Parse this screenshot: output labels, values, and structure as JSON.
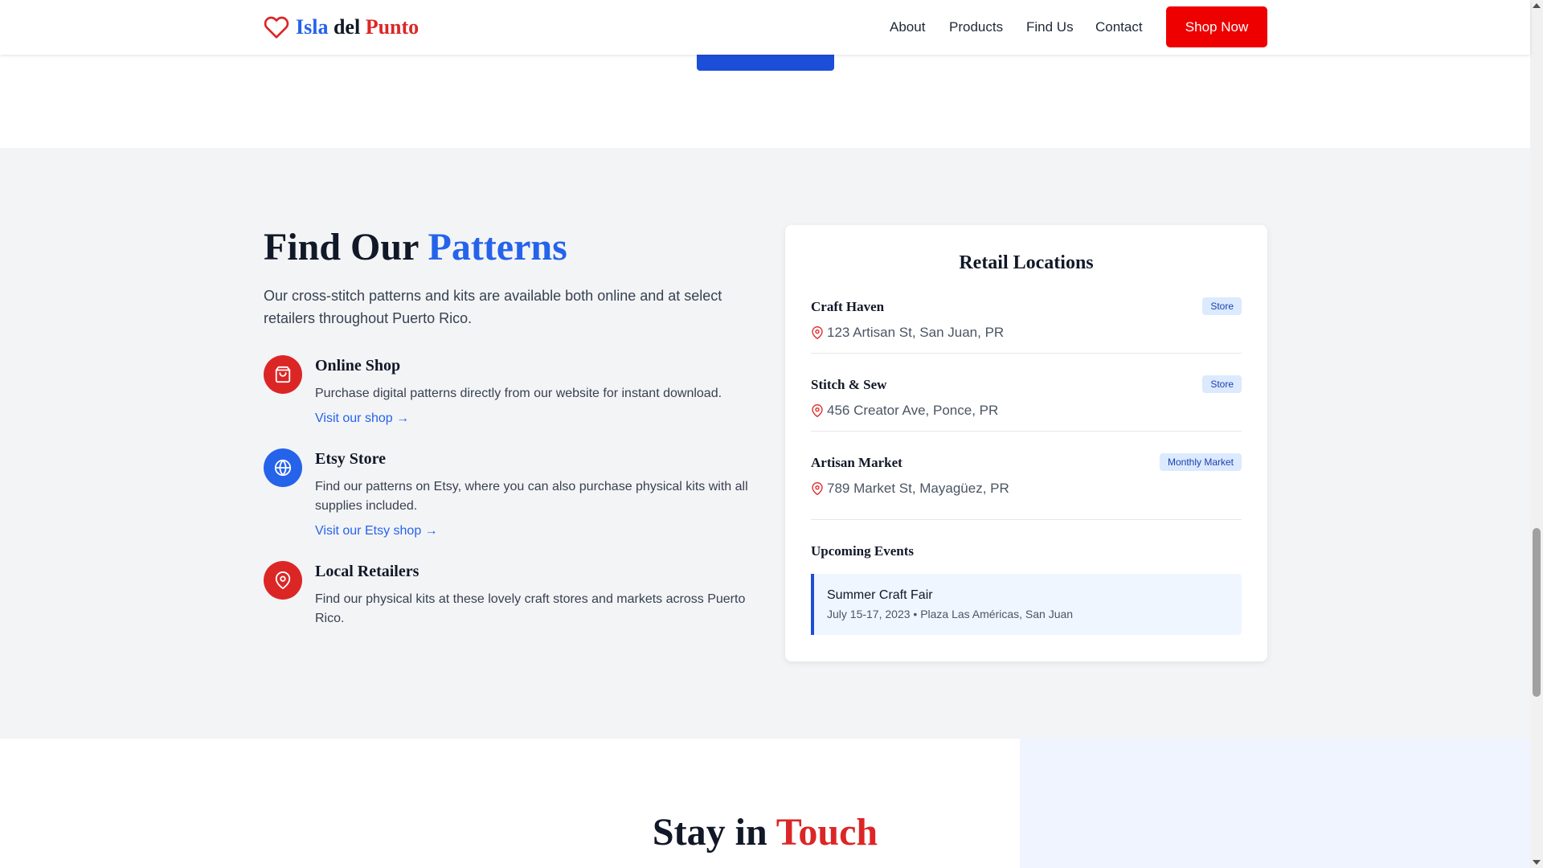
{
  "header": {
    "logo": {
      "part1": "Isla",
      "part2": " del ",
      "part3": "Punto",
      "icon": "heart-icon"
    },
    "nav": [
      "About",
      "Products",
      "Find Us",
      "Contact"
    ],
    "cta": "Shop Now"
  },
  "find": {
    "title_part1": "Find Our ",
    "title_part2": "Patterns",
    "intro": "Our cross-stitch patterns and kits are available both online and at select retailers throughout Puerto Rico.",
    "options": [
      {
        "title": "Online Shop",
        "desc": "Purchase digital patterns directly from our website for instant download.",
        "link": "Visit our shop →",
        "icon": "shopping-bag-icon",
        "color": "#dc2626"
      },
      {
        "title": "Etsy Store",
        "desc": "Find our patterns on Etsy, where you can also purchase physical kits with all supplies included.",
        "link": "Visit our Etsy shop →",
        "icon": "globe-icon",
        "color": "#2563eb"
      },
      {
        "title": "Local Retailers",
        "desc": "Find our physical kits at these lovely craft stores and markets across Puerto Rico.",
        "icon": "map-pin-icon",
        "color": "#dc2626"
      }
    ]
  },
  "retail": {
    "title": "Retail Locations",
    "locations": [
      {
        "name": "Craft Haven",
        "badge": "Store",
        "address": "123 Artisan St, San Juan, PR"
      },
      {
        "name": "Stitch & Sew",
        "badge": "Store",
        "address": "456 Creator Ave, Ponce, PR"
      },
      {
        "name": "Artisan Market",
        "badge": "Monthly Market",
        "address": "789 Market St, Mayagüez, PR"
      }
    ],
    "events_title": "Upcoming Events",
    "event": {
      "name": "Summer Craft Fair",
      "meta": "July 15-17, 2023 • Plaza Las Américas, San Juan"
    }
  },
  "contact": {
    "title_part1": "Stay in ",
    "title_part2": "Touch"
  },
  "colors": {
    "accent_blue": "#2563eb",
    "accent_red": "#dc2626",
    "cta_red": "#ee0000"
  }
}
